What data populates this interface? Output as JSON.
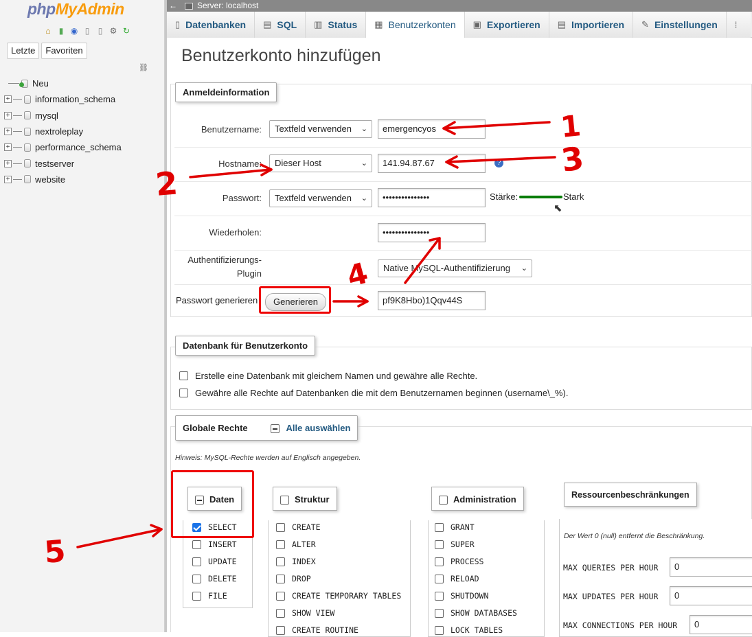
{
  "app": {
    "logo_php": "php",
    "logo_myadmin": "MyAdmin",
    "nav_tabs": [
      "Letzte",
      "Favoriten"
    ]
  },
  "tree": {
    "new_label": "Neu",
    "databases": [
      "information_schema",
      "mysql",
      "nextroleplay",
      "performance_schema",
      "testserver",
      "website"
    ]
  },
  "server_bar": {
    "back": "←",
    "title": "Server: localhost"
  },
  "tabs": [
    {
      "label": "Datenbanken",
      "icon": "database-icon",
      "glyph": "▯"
    },
    {
      "label": "SQL",
      "icon": "sql-icon",
      "glyph": "▤"
    },
    {
      "label": "Status",
      "icon": "status-icon",
      "glyph": "▥"
    },
    {
      "label": "Benutzerkonten",
      "icon": "users-icon",
      "glyph": "▦"
    },
    {
      "label": "Exportieren",
      "icon": "export-icon",
      "glyph": "▣"
    },
    {
      "label": "Importieren",
      "icon": "import-icon",
      "glyph": "▤"
    },
    {
      "label": "Einstellungen",
      "icon": "wrench-icon",
      "glyph": "✎"
    },
    {
      "label": "",
      "icon": "more-icon",
      "glyph": "⁞"
    }
  ],
  "page_title": "Benutzerkonto hinzufügen",
  "login": {
    "legend": "Anmeldeinformation",
    "username_label": "Benutzername:",
    "username_mode": "Textfeld verwenden",
    "username_value": "emergencyos",
    "hostname_label": "Hostname:",
    "hostname_mode": "Dieser Host",
    "hostname_value": "141.94.87.67",
    "password_label": "Passwort:",
    "password_mode": "Textfeld verwenden",
    "password_value": "•••••••••••••••",
    "strength_label": "Stärke:",
    "strength_value": "Stark",
    "repeat_label": "Wiederholen:",
    "repeat_value": "•••••••••••••••",
    "auth_label_1": "Authentifizierungs-",
    "auth_label_2": "Plugin",
    "auth_value": "Native MySQL-Authentifizierung",
    "generate_label": "Passwort generieren",
    "generate_button": "Generieren",
    "generated_value": "pf9K8Hbo)1Qqv44S"
  },
  "database": {
    "legend": "Datenbank für Benutzerkonto",
    "option_1": "Erstelle eine Datenbank mit gleichem Namen und gewähre alle Rechte.",
    "option_2": "Gewähre alle Rechte auf Datenbanken die mit dem Benutzernamen beginnen (username\\_%)."
  },
  "global": {
    "legend": "Globale Rechte",
    "select_all": "Alle auswählen",
    "hint": "Hinweis: MySQL-Rechte werden auf Englisch angegeben.",
    "groups": {
      "data": {
        "legend": "Daten",
        "items": [
          "SELECT",
          "INSERT",
          "UPDATE",
          "DELETE",
          "FILE"
        ],
        "checked": [
          "SELECT"
        ]
      },
      "structure": {
        "legend": "Struktur",
        "items": [
          "CREATE",
          "ALTER",
          "INDEX",
          "DROP",
          "CREATE TEMPORARY TABLES",
          "SHOW VIEW",
          "CREATE ROUTINE"
        ]
      },
      "admin": {
        "legend": "Administration",
        "items": [
          "GRANT",
          "SUPER",
          "PROCESS",
          "RELOAD",
          "SHUTDOWN",
          "SHOW DATABASES",
          "LOCK TABLES"
        ]
      }
    },
    "resources": {
      "legend": "Ressourcenbeschränkungen",
      "hint": "Der Wert 0 (null) entfernt die Beschränkung.",
      "rows": [
        {
          "label": "MAX QUERIES PER HOUR",
          "value": "0"
        },
        {
          "label": "MAX UPDATES PER HOUR",
          "value": "0"
        },
        {
          "label": "MAX CONNECTIONS PER HOUR",
          "value": "0"
        }
      ]
    }
  },
  "annotations": [
    "1",
    "2",
    "3",
    "4",
    "5"
  ],
  "colors": {
    "accent": "#235a81",
    "strength": "#0a7d0a",
    "annotation": "#e00000",
    "logo_php": "#6c78af",
    "logo_myadmin": "#f89c0e"
  }
}
